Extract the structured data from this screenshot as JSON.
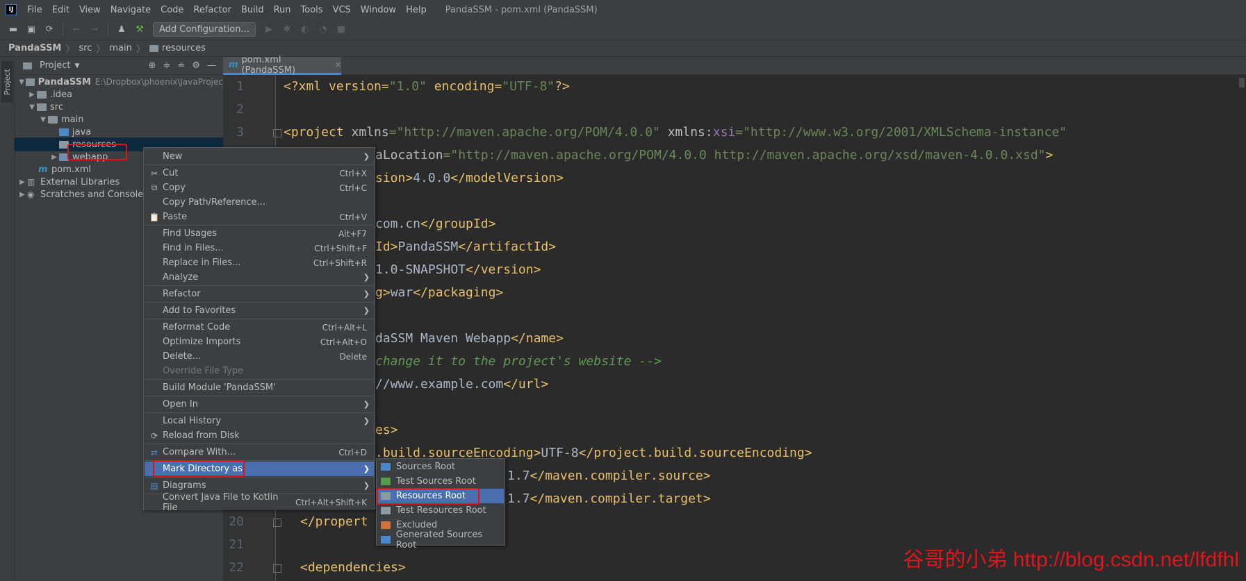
{
  "window": {
    "title": "PandaSSM - pom.xml (PandaSSM)",
    "logo": "IJ"
  },
  "menubar": {
    "items": [
      "File",
      "Edit",
      "View",
      "Navigate",
      "Code",
      "Refactor",
      "Build",
      "Run",
      "Tools",
      "VCS",
      "Window",
      "Help"
    ]
  },
  "toolbar": {
    "add_config_label": "Add Configuration..."
  },
  "breadcrumb": {
    "items": [
      "PandaSSM",
      "src",
      "main",
      "resources"
    ]
  },
  "toolstrip": {
    "project_tab": "Project"
  },
  "project_panel": {
    "title": "Project",
    "tree": [
      {
        "label": "PandaSSM",
        "note": "E:\\Dropbox\\phoenix\\JavaProjec"
      },
      {
        "label": ".idea"
      },
      {
        "label": "src"
      },
      {
        "label": "main"
      },
      {
        "label": "java"
      },
      {
        "label": "resources"
      },
      {
        "label": "webapp"
      },
      {
        "label": "pom.xml"
      },
      {
        "label": "External Libraries"
      },
      {
        "label": "Scratches and Consoles"
      }
    ]
  },
  "editor": {
    "tab_label": "pom.xml (PandaSSM)",
    "line_numbers": [
      "1",
      "2",
      "3",
      "20",
      "21",
      "22"
    ],
    "lines": {
      "l1": {
        "a": "<?xml version=",
        "b": "\"1.0\"",
        "c": " encoding=",
        "d": "\"UTF-8\"",
        "e": "?>"
      },
      "l3": {
        "a": "<project ",
        "b": "xmlns",
        "c": "=",
        "d": "\"http://maven.apache.org/POM/4.0.0\"",
        "e": " xmlns:",
        "f": "xsi",
        "g": "=",
        "h": "\"http://www.w3.org/2001/XMLSchema-instance\""
      },
      "l4": {
        "a": "aLocation",
        "b": "=",
        "c": "\"http://maven.apache.org/POM/4.0.0 http://maven.apache.org/xsd/maven-4.0.0.xsd\"",
        "d": ">"
      },
      "l5": {
        "a": "sion>",
        "b": "4.0.0",
        "c": "</modelVersion>"
      },
      "l7": {
        "a": "com.cn",
        "b": "</groupId>"
      },
      "l8": {
        "a": "Id>",
        "b": "PandaSSM",
        "c": "</artifactId>"
      },
      "l9": {
        "a": "1.0-SNAPSHOT",
        "b": "</version>"
      },
      "l10": {
        "a": "g>",
        "b": "war",
        "c": "</packaging>"
      },
      "l12": {
        "a": "daSSM Maven Webapp",
        "b": "</name>"
      },
      "l13": {
        "a": "change it to the project's website ",
        "b": "-->"
      },
      "l14": {
        "a": "//www.example.com",
        "b": "</url>"
      },
      "l16": {
        "a": "es>"
      },
      "l17": {
        "a": ".build.sourceEncoding>",
        "b": "UTF-8",
        "c": "</project.build.sourceEncoding>"
      },
      "l18": {
        "a": "1.7",
        "b": "</maven.compiler.source>"
      },
      "l19": {
        "a": "1.7",
        "b": "</maven.compiler.target>"
      },
      "l20": {
        "a": "</propert"
      },
      "l22": {
        "a": "<dependencies>"
      }
    }
  },
  "context_menu": {
    "items": [
      {
        "label": "New",
        "shortcut": "",
        "submenu": true
      },
      {
        "label": "Cut",
        "shortcut": "Ctrl+X"
      },
      {
        "label": "Copy",
        "shortcut": "Ctrl+C"
      },
      {
        "label": "Copy Path/Reference...",
        "shortcut": ""
      },
      {
        "label": "Paste",
        "shortcut": "Ctrl+V"
      },
      {
        "label": "Find Usages",
        "shortcut": "Alt+F7"
      },
      {
        "label": "Find in Files...",
        "shortcut": "Ctrl+Shift+F"
      },
      {
        "label": "Replace in Files...",
        "shortcut": "Ctrl+Shift+R"
      },
      {
        "label": "Analyze",
        "shortcut": "",
        "submenu": true
      },
      {
        "label": "Refactor",
        "shortcut": "",
        "submenu": true
      },
      {
        "label": "Add to Favorites",
        "shortcut": "",
        "submenu": true
      },
      {
        "label": "Reformat Code",
        "shortcut": "Ctrl+Alt+L"
      },
      {
        "label": "Optimize Imports",
        "shortcut": "Ctrl+Alt+O"
      },
      {
        "label": "Delete...",
        "shortcut": "Delete"
      },
      {
        "label": "Override File Type",
        "shortcut": "",
        "disabled": true
      },
      {
        "label": "Build Module 'PandaSSM'",
        "shortcut": ""
      },
      {
        "label": "Open In",
        "shortcut": "",
        "submenu": true
      },
      {
        "label": "Local History",
        "shortcut": "",
        "submenu": true
      },
      {
        "label": "Reload from Disk",
        "shortcut": ""
      },
      {
        "label": "Compare With...",
        "shortcut": "Ctrl+D"
      },
      {
        "label": "Mark Directory as",
        "shortcut": "",
        "submenu": true,
        "highlighted": true
      },
      {
        "label": "Diagrams",
        "shortcut": "",
        "submenu": true
      },
      {
        "label": "Convert Java File to Kotlin File",
        "shortcut": "Ctrl+Alt+Shift+K"
      }
    ]
  },
  "submenu": {
    "items": [
      {
        "label": "Sources Root",
        "color": "#4a88c7"
      },
      {
        "label": "Test Sources Root",
        "color": "#5a9a4e"
      },
      {
        "label": "Resources Root",
        "color": "#8e9aa2",
        "highlighted": true
      },
      {
        "label": "Test Resources Root",
        "color": "#8e9aa2"
      },
      {
        "label": "Excluded",
        "color": "#d0733b"
      },
      {
        "label": "Generated Sources Root",
        "color": "#4a88c7"
      }
    ]
  },
  "watermark": "谷哥的小弟 http://blog.csdn.net/lfdfhl",
  "colors": {
    "highlight": "#4b6eaf",
    "annotation_red": "#e0131b",
    "background": "#2b2b2b"
  }
}
